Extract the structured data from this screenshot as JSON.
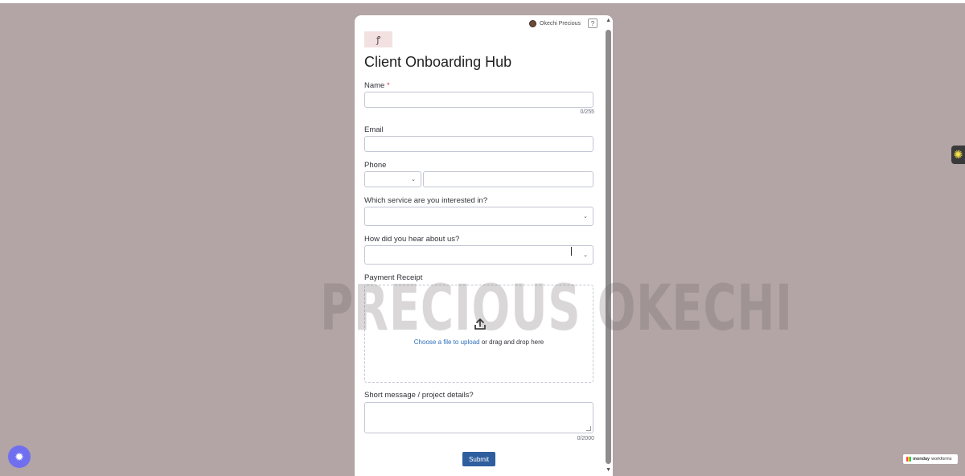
{
  "form": {
    "title": "Client Onboarding Hub",
    "logo_glyph": "ꝭ",
    "user": {
      "name": "Okechi Precious"
    },
    "help_label": "?",
    "fields": {
      "name": {
        "label": "Name",
        "required_mark": "*",
        "value": "",
        "counter": "0/255"
      },
      "email": {
        "label": "Email",
        "value": ""
      },
      "phone": {
        "label": "Phone",
        "country_value": "",
        "value": ""
      },
      "service": {
        "label": "Which service are you interested in?",
        "value": ""
      },
      "referral": {
        "label": "How did you hear about us?",
        "value": ""
      },
      "receipt": {
        "label": "Payment Receipt",
        "upload_link": "Choose a file to upload",
        "upload_rest": "or drag and drop here"
      },
      "message": {
        "label": "Short message / project details?",
        "value": "",
        "counter": "0/2000"
      }
    },
    "submit_label": "Submit"
  },
  "watermark": "PRECIOUS OKECHI",
  "badge": {
    "brand": "monday",
    "product": "workforms"
  },
  "icons": {
    "upload": "upload-icon",
    "chevron": "chevron-down-icon",
    "side_tab": "sunburst-icon",
    "fab": "accessibility-icon"
  },
  "colors": {
    "background": "#b3a4a5",
    "submit": "#2e5e9e",
    "link": "#2f6fba",
    "required": "#d83a52"
  }
}
